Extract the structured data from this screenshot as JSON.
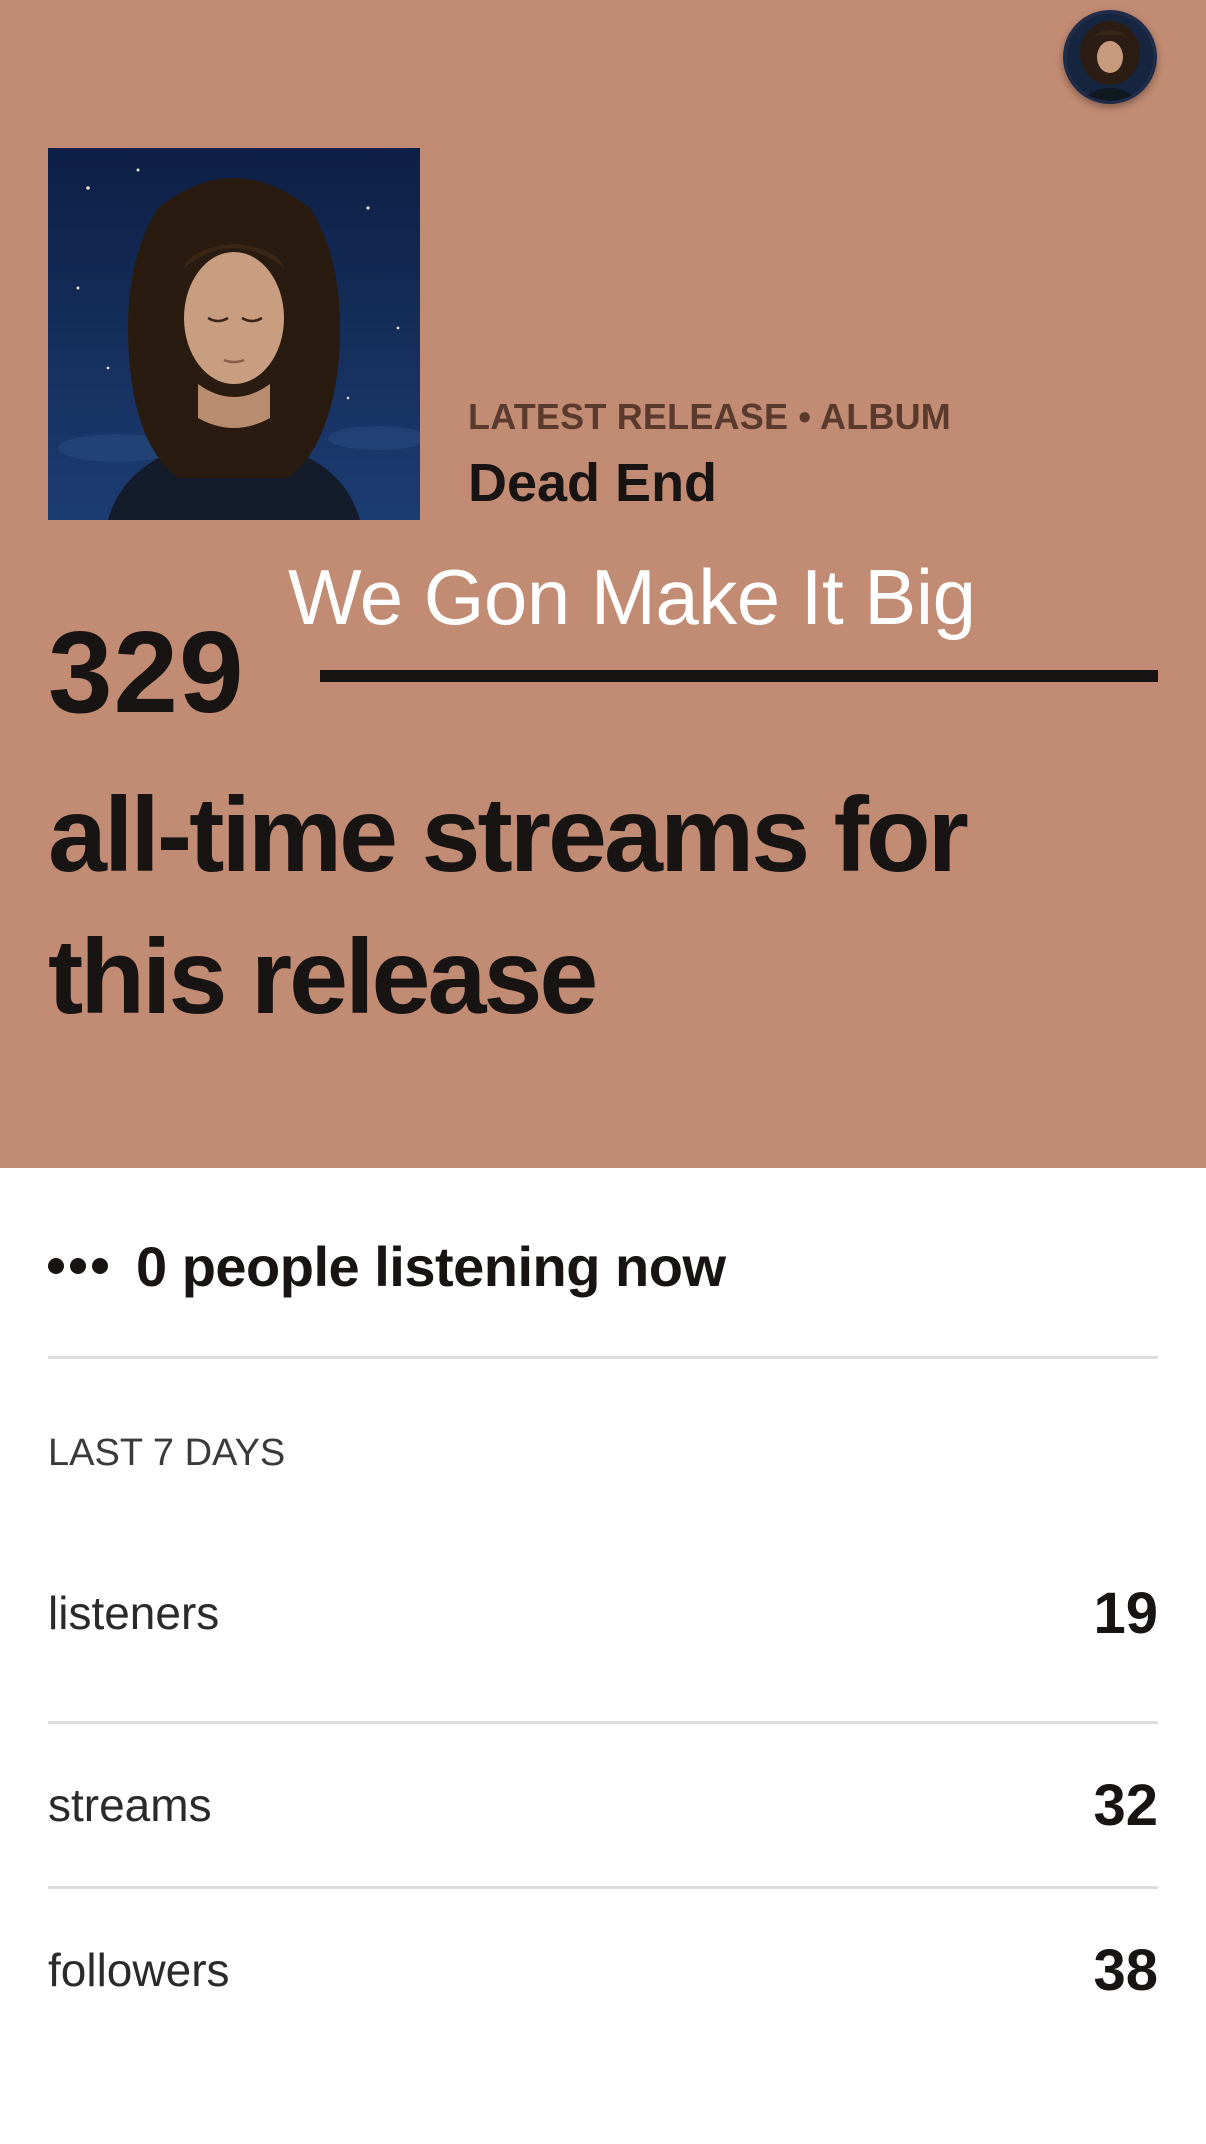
{
  "hero": {
    "background_color": "#c28b73",
    "kicker": "LATEST RELEASE • ALBUM",
    "release_title": "Dead End",
    "track_overlay": "We Gon Make It Big",
    "stream_count": "329",
    "stream_caption": "all-time streams for this release"
  },
  "live": {
    "icon": "more-dots-icon",
    "text": "0 people listening now"
  },
  "stats": {
    "section_label": "LAST 7 DAYS",
    "rows": [
      {
        "label": "listeners",
        "value": "19"
      },
      {
        "label": "streams",
        "value": "32"
      },
      {
        "label": "followers",
        "value": "38"
      }
    ]
  }
}
